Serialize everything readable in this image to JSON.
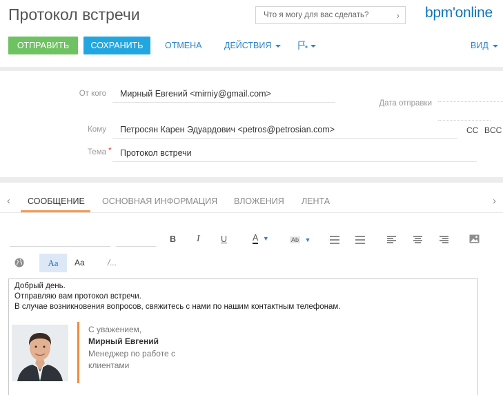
{
  "header": {
    "title": "Протокол встречи",
    "search_placeholder": "Что я могу для вас сделать?",
    "logo_text": "bpm'online"
  },
  "toolbar": {
    "send_label": "ОТПРАВИТЬ",
    "save_label": "СОХРАНИТЬ",
    "cancel_label": "ОТМЕНА",
    "actions_label": "ДЕЙСТВИЯ",
    "view_label": "ВИД",
    "send_color": "#6fc262",
    "save_color": "#22a6e0",
    "link_color": "#2b84c6"
  },
  "email": {
    "from_label": "От кого",
    "from_value": "Мирный Евгений <mirniy@gmail.com>",
    "sent_date_label": "Дата отправки",
    "to_label": "Кому",
    "to_value": "Петросян Карен Эдуардович <petros@petrosian.com>",
    "cc_label": "CC",
    "bcc_label": "BCC",
    "subject_label": "Тема",
    "subject_value": "Протокол встречи"
  },
  "tabs": [
    {
      "label": "СООБЩЕНИЕ",
      "active": true
    },
    {
      "label": "ОСНОВНАЯ ИНФОРМАЦИЯ",
      "active": false
    },
    {
      "label": "ВЛОЖЕНИЯ",
      "active": false
    },
    {
      "label": "ЛЕНТА",
      "active": false
    }
  ],
  "editor_toolbar": {
    "bold": "B",
    "italic": "I",
    "underline": "U",
    "font_color": "A",
    "highlight": "Ab",
    "rich_text": "Aa",
    "plain_text": "Aa",
    "source": "/..."
  },
  "message": {
    "lines": [
      "Добрый день.",
      "Отправляю вам протокол встречи.",
      "В случае возникновения вопросов, свяжитесь с нами по нашим контактным телефонам."
    ],
    "signature": {
      "regards": "С уважением,",
      "name": "Мирный Евгений",
      "position_line1": "Менеджер по работе с",
      "position_line2": "клиентами"
    }
  },
  "colors": {
    "tab_accent": "#f29a53",
    "signature_bar": "#f08a3d",
    "logo": "#0d76b8"
  }
}
